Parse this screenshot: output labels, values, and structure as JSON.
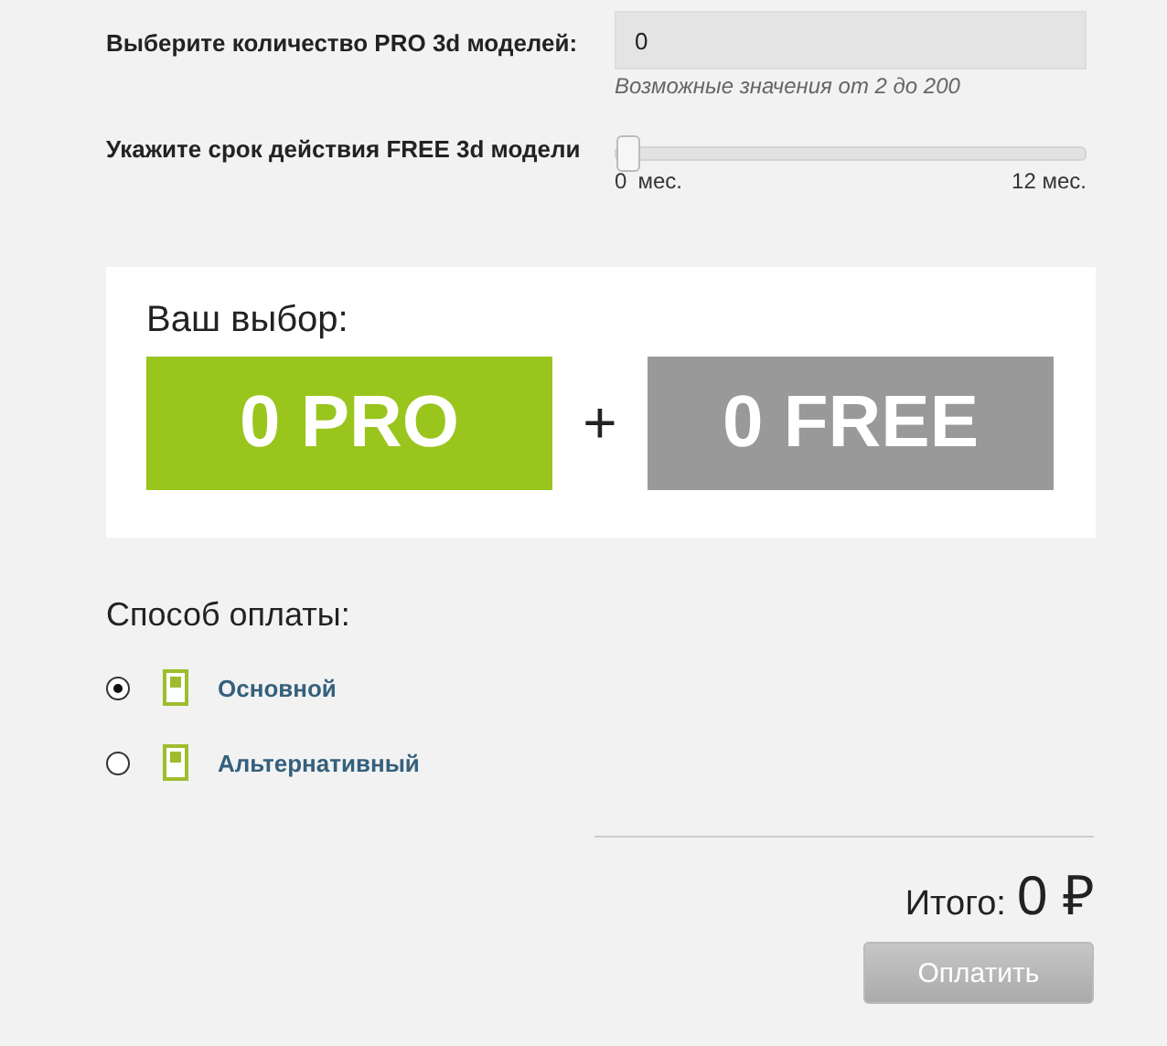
{
  "pro_count": {
    "label": "Выберите количество PRO 3d моделей:",
    "value": "0",
    "hint": "Возможные значения от 2 до 200"
  },
  "free_term": {
    "label": "Укажите срок действия FREE 3d модели",
    "level": 0,
    "min_label": "0",
    "unit_label": "мес.",
    "max_label": "12 мес."
  },
  "choice": {
    "title": "Ваш выбор:",
    "pro": "0 PRO",
    "plus": "+",
    "free": "0 FREE"
  },
  "payment": {
    "title": "Способ оплаты:",
    "options": [
      {
        "label": "Основной",
        "selected": true
      },
      {
        "label": "Альтернативный",
        "selected": false
      }
    ]
  },
  "total": {
    "label": "Итого:",
    "amount": "0 ₽"
  },
  "pay_button": {
    "label": "Оплатить",
    "disabled": true
  }
}
